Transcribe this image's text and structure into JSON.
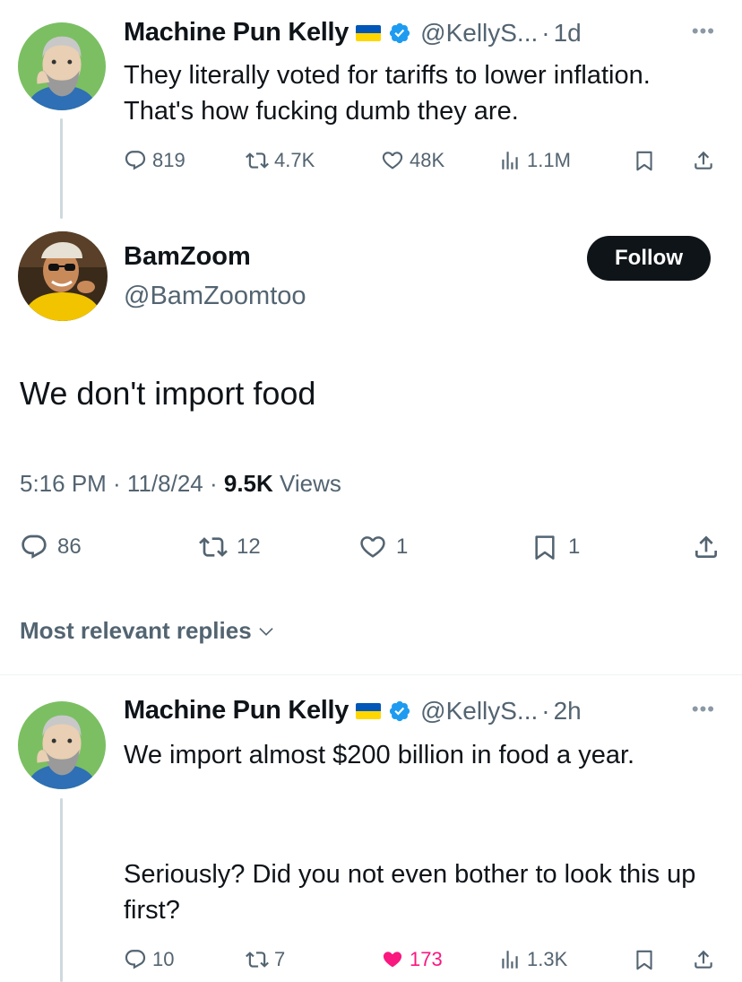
{
  "tweet1": {
    "name": "Machine Pun Kelly",
    "handle": "@KellyS...",
    "time": "1d",
    "text": "They literally voted for tariffs to lower inflation. That's how fucking dumb they are.",
    "replies": "819",
    "reposts": "4.7K",
    "likes": "48K",
    "views": "1.1M"
  },
  "main": {
    "name": "BamZoom",
    "handle": "@BamZoomtoo",
    "follow_label": "Follow",
    "text": "We don't import food",
    "time": "5:16 PM · 11/8/24 · ",
    "views_count": "9.5K",
    "views_label": " Views",
    "replies": "86",
    "reposts": "12",
    "likes": "1",
    "bookmarks": "1"
  },
  "replies_header": "Most relevant replies",
  "tweet2": {
    "name": "Machine Pun Kelly",
    "handle": "@KellyS...",
    "time": "2h",
    "text_p1": "We import almost $200 billion in food a year.",
    "text_p2": "Seriously? Did you not even bother to look this up first?",
    "replies": "10",
    "reposts": "7",
    "likes": "173",
    "views": "1.3K"
  },
  "icons": {
    "reply": "reply-icon",
    "repost": "repost-icon",
    "like": "heart-icon",
    "views": "views-icon",
    "bookmark": "bookmark-icon",
    "share": "share-icon",
    "verified": "verified-badge-icon",
    "flag": "ukraine-flag-icon",
    "more": "more-icon"
  },
  "colors": {
    "verified": "#1d9bf0",
    "like_active": "#f91880",
    "muted_text": "#536471",
    "flag_blue": "#0057b7",
    "flag_yellow": "#ffd700"
  }
}
